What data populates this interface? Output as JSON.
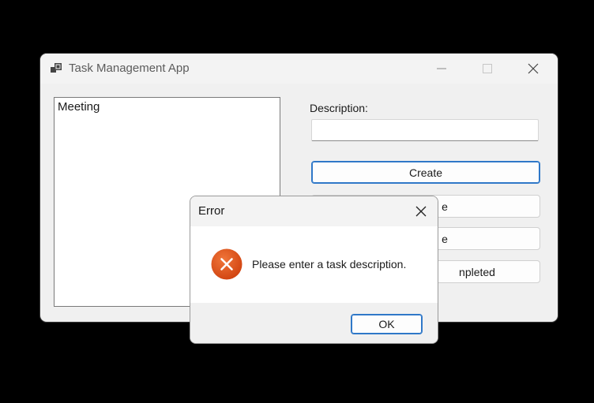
{
  "main_window": {
    "title": "Task Management App",
    "app_icon": "app-icon",
    "controls": {
      "minimize_icon": "minimize-icon",
      "maximize_icon": "maximize-icon",
      "close_icon": "close-icon"
    }
  },
  "task_list": {
    "items": [
      "Meeting"
    ]
  },
  "form": {
    "description_label": "Description:",
    "description_value": ""
  },
  "buttons": {
    "create": "Create",
    "button_2_visible": "e",
    "button_3_visible": "e",
    "button_4_visible": "npleted"
  },
  "dialog": {
    "title": "Error",
    "message": "Please enter a task description.",
    "ok_label": "OK",
    "icon": "error-icon",
    "error_color": "#e0521a"
  },
  "colors": {
    "accent": "#2f78c8",
    "background": "#000000",
    "window": "#f0f0f0"
  }
}
